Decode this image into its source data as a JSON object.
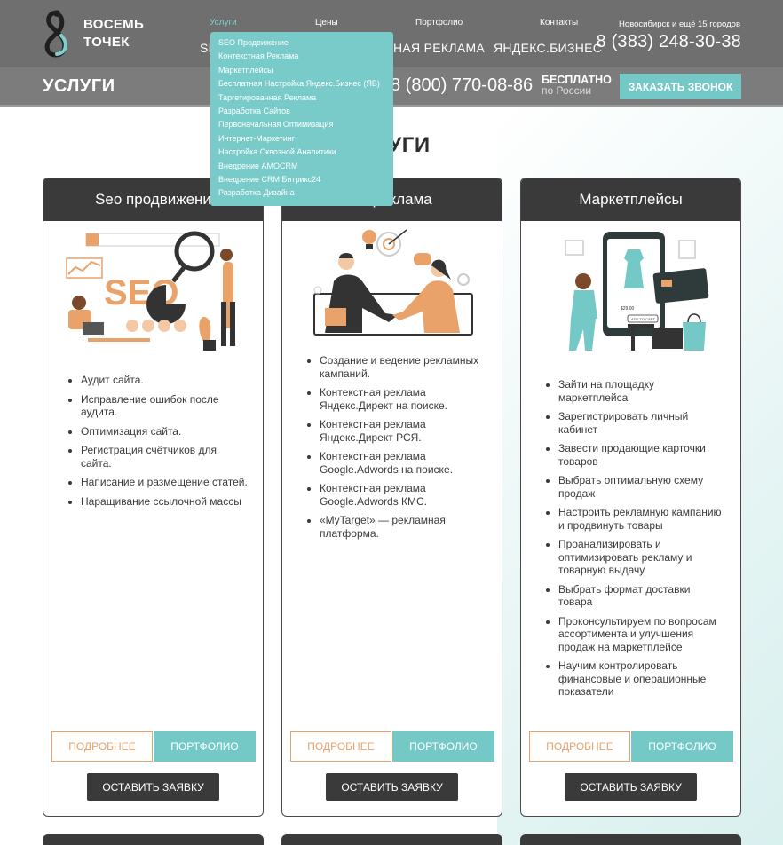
{
  "header": {
    "logo_line1": "ВОСЕМЬ",
    "logo_line2": "ТОЧЕК",
    "nav_top": [
      "Услуги",
      "Цены",
      "Портфолио",
      "Контакты"
    ],
    "nav_big": [
      "SE",
      "НАЯ РЕКЛАМА",
      "ЯНДЕКС.БИЗНЕС"
    ],
    "city": "Новосибирск и ещё 15 городов",
    "phone": "8 (383) 248-30-38"
  },
  "subheader": {
    "title": "УСЛУГИ",
    "phone": "8 (800) 770-08-86",
    "free_line1": "БЕСПЛАТНО",
    "free_line2": "по России",
    "call_button": "ЗАКАЗАТЬ ЗВОНОК"
  },
  "dropdown": [
    "SEO Продвижение",
    "Контекстная Реклама",
    "Маркетплейсы",
    "Бесплатная Настройка Яндекс.Бизнес (ЯБ)",
    "Таргетированная Реклама",
    "Разработка Сайтов",
    "Первоначальная Оптимизация",
    "Интернет-Маркетинг",
    "Настройка Сквозной Аналитики",
    "Внедрение AMOCRM",
    "Внедрение CRM Битрикс24",
    "Разработка Дизайна"
  ],
  "section_title": "УГИ",
  "cards": [
    {
      "title": "Seo продвижени",
      "items": [
        "Аудит сайта.",
        "Исправление ошибок после аудита.",
        "Оптимизация сайта.",
        "Регистрация счётчиков для сайта.",
        "Написание и размещение статей.",
        "Наращивание ссылочной массы"
      ]
    },
    {
      "title": "ая реклама",
      "items": [
        "Создание и ведение рекламных кампаний.",
        "Контекстная реклама Яндекс.Директ на поиске.",
        "Контекстная реклама Яндекс.Директ РСЯ.",
        "Контекстная реклама Google.Adwords на поиске.",
        "Контекстная реклама Google.Adwords КМС.",
        "«MyTarget» — рекламная платформа."
      ]
    },
    {
      "title": "Маркетплейсы",
      "items": [
        "Зайти на площадку маркетплейса",
        "Зарегистрировать личный кабинет",
        "Завести продающие карточки товаров",
        "Выбрать оптимальную схему продаж",
        "Настроить рекламную кампанию и продвинуть товары",
        "Проанализировать и оптимизировать рекламу и товарную выдачу",
        "Выбрать формат доставки товара",
        "Проконсультируем по вопросам ассортимента и улучшения продаж на маркетплейсе",
        "Научим контролировать финансовые и операционные показатели"
      ]
    }
  ],
  "buttons": {
    "more": "ПОДРОБНЕЕ",
    "portfolio": "ПОРТФОЛИО",
    "request": "ОСТАВИТЬ ЗАЯВКУ"
  },
  "seo_art_text": "SEO",
  "cart_label": "ADD TO CART",
  "price_label": "$29.00",
  "colors": {
    "header_bg": "#6f6f6f",
    "subheader_bg": "#7c7c7c",
    "accent": "#74c9c6",
    "orange": "#e8a26a",
    "dark": "#3a3a3a"
  }
}
